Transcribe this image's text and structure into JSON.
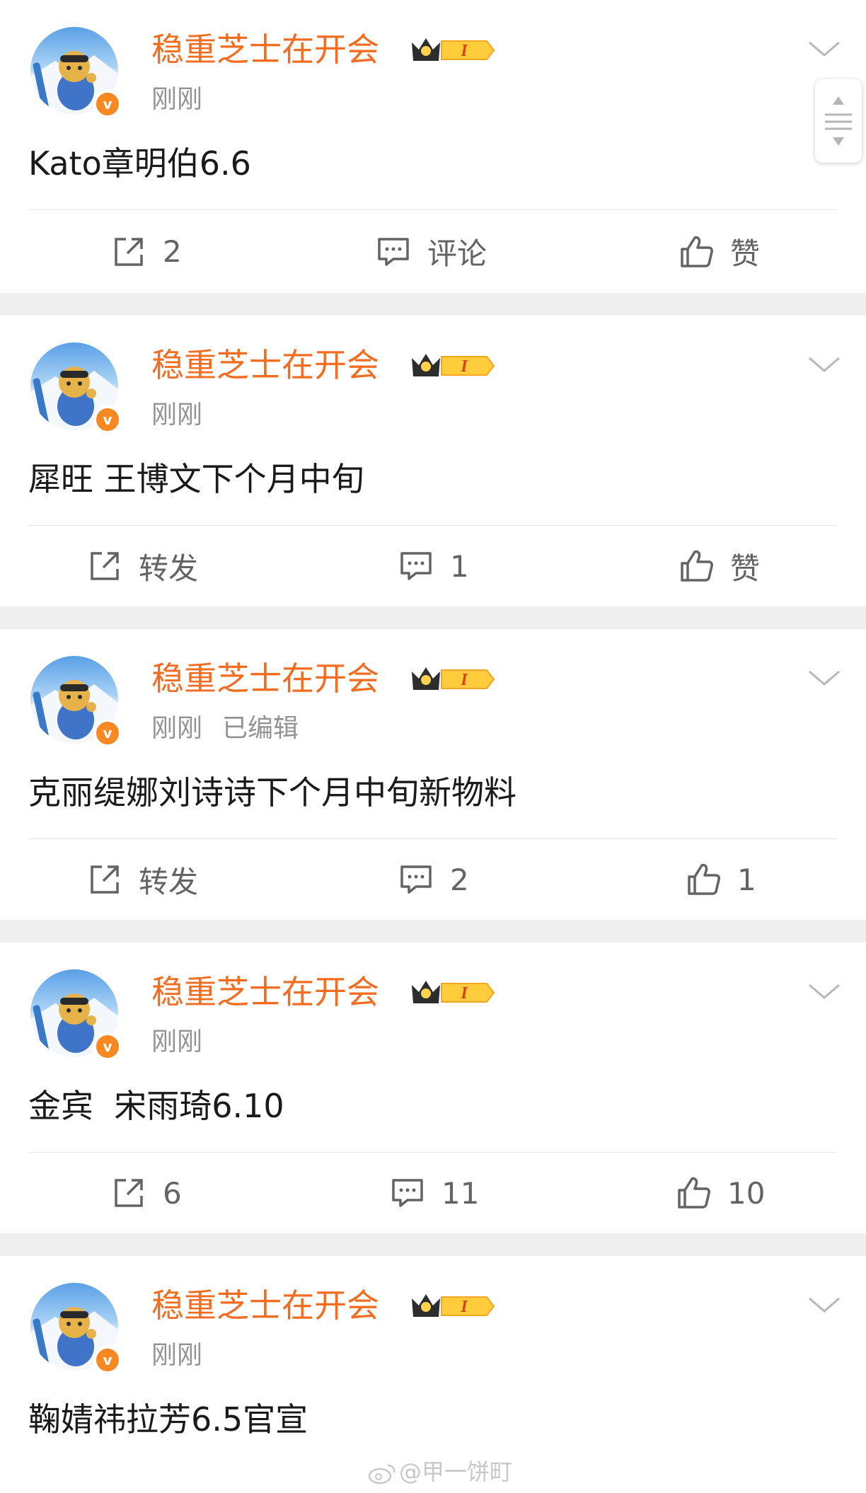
{
  "posts": [
    {
      "author": "稳重芝士在开会",
      "vip_badge": "I",
      "time": "刚刚",
      "edited": "",
      "content": "Kato章明伯6.6",
      "repost": "2",
      "comment": "评论",
      "like": "赞"
    },
    {
      "author": "稳重芝士在开会",
      "vip_badge": "I",
      "time": "刚刚",
      "edited": "",
      "content": "犀旺 王博文下个月中旬",
      "repost": "转发",
      "comment": "1",
      "like": "赞"
    },
    {
      "author": "稳重芝士在开会",
      "vip_badge": "I",
      "time": "刚刚",
      "edited": "已编辑",
      "content": "克丽缇娜刘诗诗下个月中旬新物料",
      "repost": "转发",
      "comment": "2",
      "like": "1"
    },
    {
      "author": "稳重芝士在开会",
      "vip_badge": "I",
      "time": "刚刚",
      "edited": "",
      "content": "金宾  宋雨琦6.10",
      "repost": "6",
      "comment": "11",
      "like": "10"
    },
    {
      "author": "稳重芝士在开会",
      "vip_badge": "I",
      "time": "刚刚",
      "edited": "",
      "content": "鞠婧祎拉芳6.5官宣"
    }
  ],
  "verified_mark": "v",
  "watermark": "@甲一饼町",
  "colors": {
    "name": "#f26d22",
    "verified": "#f78822",
    "meta": "#939393",
    "action": "#636363",
    "divider_band": "#efefef"
  },
  "icons": {
    "avatar": "bear-snowboard-avatar",
    "menu": "chevron-down-icon",
    "repost": "repost-icon",
    "comment": "comment-icon",
    "like": "thumbs-up-icon",
    "scroll": "scroll-handle-icon"
  }
}
